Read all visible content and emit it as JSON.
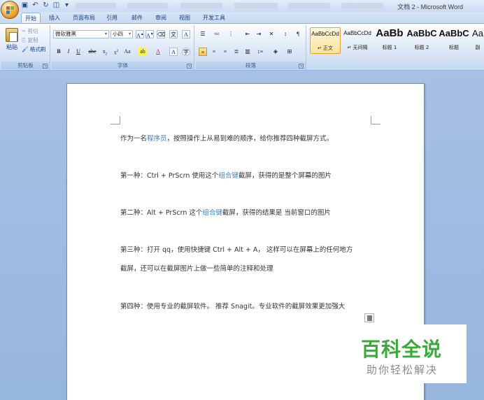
{
  "window": {
    "title": "文档 2 - Microsoft Word"
  },
  "tabs": [
    "开始",
    "插入",
    "页面布局",
    "引用",
    "邮件",
    "审阅",
    "视图",
    "开发工具"
  ],
  "clipboard": {
    "paste": "粘贴",
    "cut": "剪切",
    "copy": "复制",
    "format_painter": "格式刷",
    "group_label": "剪贴板"
  },
  "font": {
    "family": "微软雅黑",
    "size": "小四",
    "group_label": "字体"
  },
  "paragraph": {
    "group_label": "段落"
  },
  "styles": [
    {
      "sample": "AaBbCcDd",
      "name": "↵ 正文"
    },
    {
      "sample": "AaBbCcDd",
      "name": "↵ 无间隔"
    },
    {
      "sample": "AaBb",
      "name": "标题 1"
    },
    {
      "sample": "AaBbC",
      "name": "标题 2"
    },
    {
      "sample": "AaBbC",
      "name": "标题"
    },
    {
      "sample": "Aa",
      "name": "副"
    }
  ],
  "document": {
    "lines": [
      {
        "pre": "作为一名",
        "link": "程序员",
        "post": "，按照操作上从易到难的顺序，给你推荐四种截屏方式。"
      },
      {
        "pre": "第一种：Ctrl + PrScrn  使用这个",
        "link": "组合键",
        "post": "截屏，获得的是整个屏幕的图片"
      },
      {
        "pre": "第二种：Alt + PrScrn  这个",
        "link": "组合键",
        "post": "截屏，获得的结果是  当前窗口的图片"
      },
      {
        "pre": "第三种：打开 qq，使用快捷键  Ctrl + Alt + A，  这样可以在屏幕上的任何地方",
        "link": "",
        "post": ""
      },
      {
        "pre": "截屏，还可以在截屏图片上做一些简单的注释和处理",
        "link": "",
        "post": ""
      },
      {
        "pre": "第四种：使用专业的截屏软件。  推荐 Snagit。专业软件的截屏效果更加强大",
        "link": "",
        "post": ""
      }
    ]
  },
  "watermark": {
    "main": "百科全说",
    "sub": "助你轻松解决"
  },
  "colors": {
    "accent_green": "#3aaa3a",
    "link_blue": "#3a7fc3"
  }
}
